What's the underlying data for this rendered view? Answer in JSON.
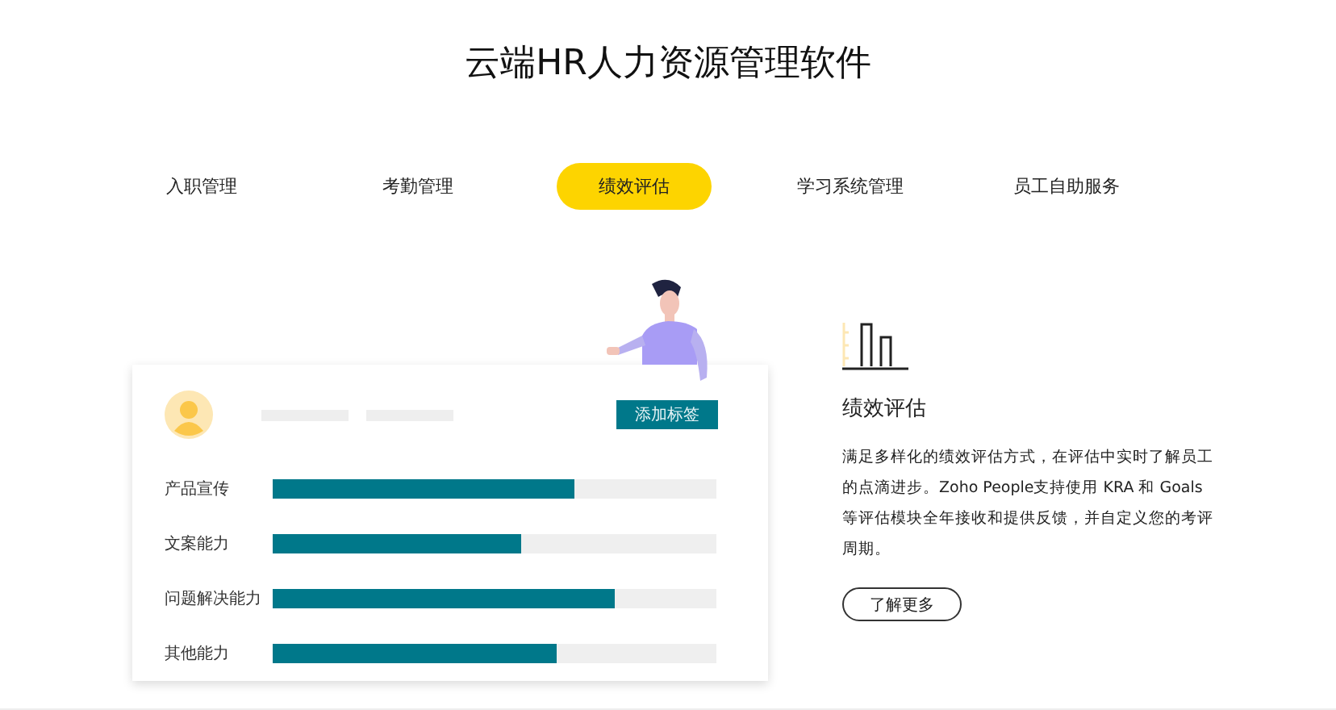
{
  "title": "云端HR人力资源管理软件",
  "tabs": [
    {
      "label": "入职管理",
      "selected": false
    },
    {
      "label": "考勤管理",
      "selected": false
    },
    {
      "label": "绩效评估",
      "selected": true
    },
    {
      "label": "学习系统管理",
      "selected": false
    },
    {
      "label": "员工自助服务",
      "selected": false
    }
  ],
  "card": {
    "tag_button": "添加标签",
    "skills": [
      {
        "name": "产品宣传",
        "level": 0.68
      },
      {
        "name": "文案能力",
        "level": 0.56
      },
      {
        "name": "问题解决能力",
        "level": 0.77
      },
      {
        "name": "其他能力",
        "level": 0.64
      }
    ]
  },
  "feature": {
    "title": "绩效评估",
    "description": "满足多样化的绩效评估方式，在评估中实时了解员工的点滴进步。Zoho People支持使用 KRA 和 Goals 等评估模块全年接收和提供反馈，并自定义您的考评周期。",
    "button": "了解更多"
  }
}
